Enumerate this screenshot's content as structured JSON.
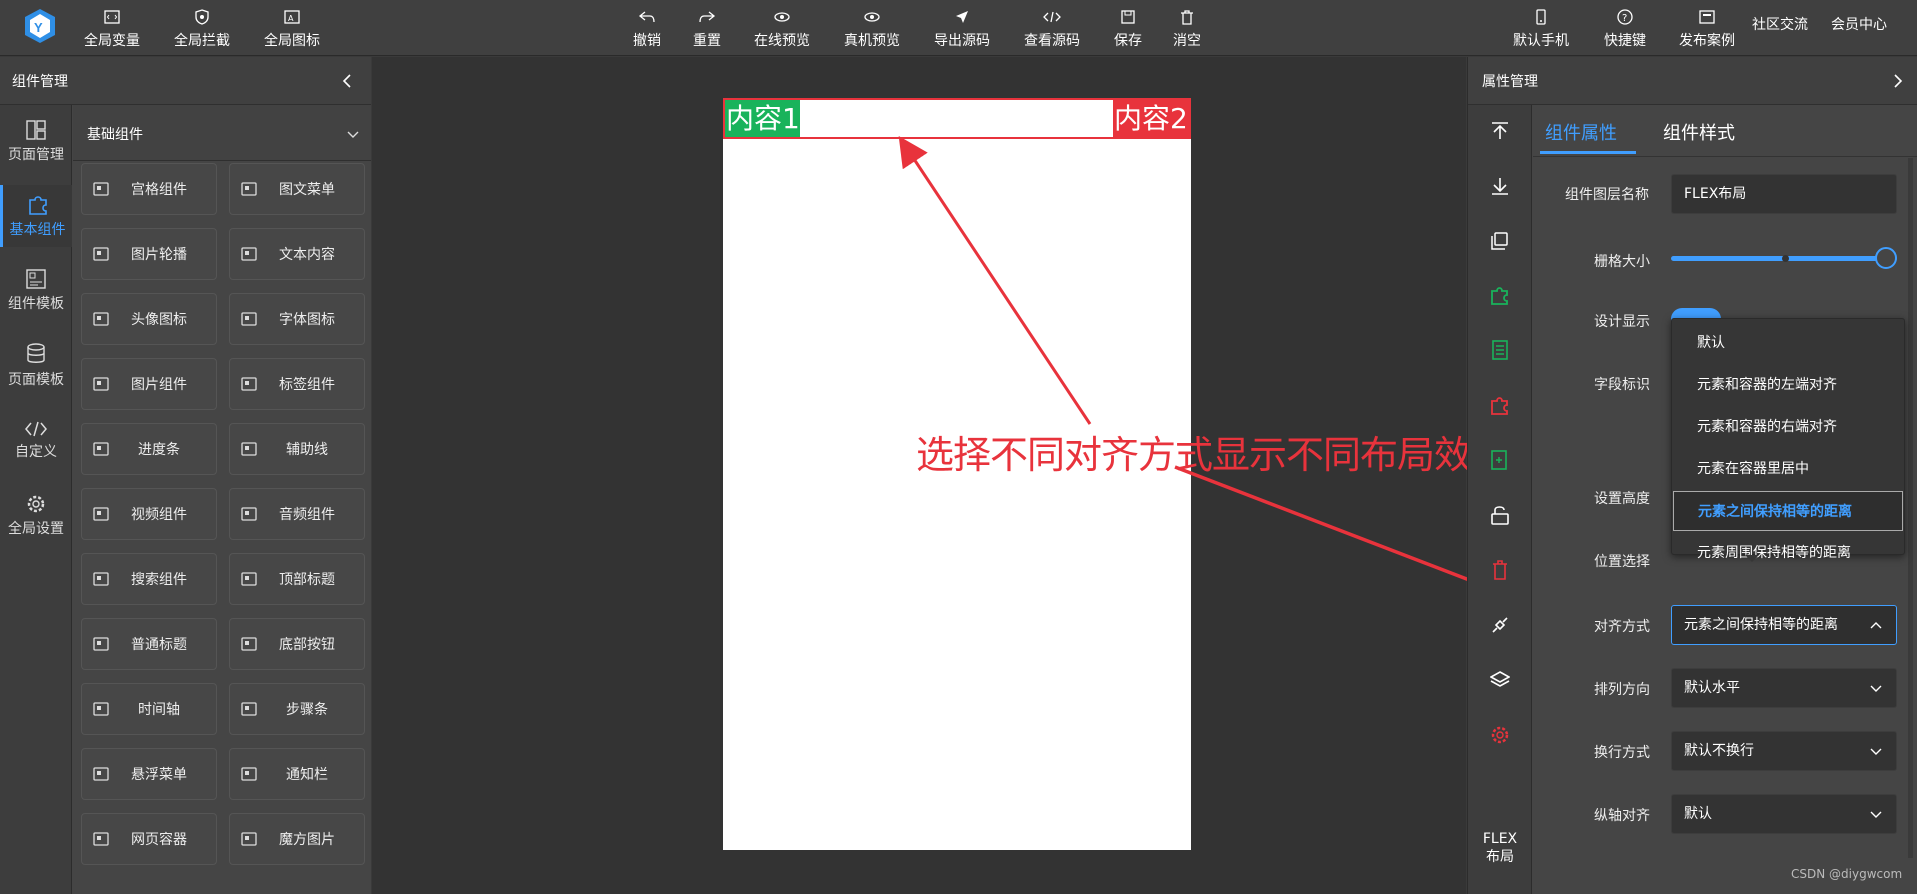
{
  "topbar": {
    "left": [
      {
        "label": "全局变量",
        "icon": "code-box-icon"
      },
      {
        "label": "全局拦截",
        "icon": "shield-icon"
      },
      {
        "label": "全局图标",
        "icon": "image-box-icon"
      }
    ],
    "center": [
      {
        "label": "撤销",
        "icon": "undo-icon"
      },
      {
        "label": "重置",
        "icon": "redo-icon"
      },
      {
        "label": "在线预览",
        "icon": "eye-icon"
      },
      {
        "label": "真机预览",
        "icon": "eye-icon"
      },
      {
        "label": "导出源码",
        "icon": "send-icon"
      },
      {
        "label": "查看源码",
        "icon": "code-icon"
      },
      {
        "label": "保存",
        "icon": "save-icon"
      },
      {
        "label": "消空",
        "icon": "trash-icon"
      }
    ],
    "right": [
      {
        "label": "默认手机",
        "icon": "phone-icon"
      },
      {
        "label": "快捷键",
        "icon": "question-icon"
      },
      {
        "label": "发布案例",
        "icon": "publish-icon"
      }
    ],
    "links": [
      "社区交流",
      "会员中心"
    ]
  },
  "left_panel": {
    "title": "组件管理",
    "nav": [
      {
        "label": "页面管理",
        "icon": "layout-icon",
        "active": false
      },
      {
        "label": "基本组件",
        "icon": "puzzle-icon",
        "active": true
      },
      {
        "label": "组件模板",
        "icon": "template-icon",
        "active": false
      },
      {
        "label": "页面模板",
        "icon": "database-icon",
        "active": false
      },
      {
        "label": "自定义",
        "icon": "code-icon",
        "active": false
      },
      {
        "label": "全局设置",
        "icon": "gear-icon",
        "active": false
      }
    ],
    "category": "基础组件",
    "components": [
      [
        "宫格组件",
        "图文菜单"
      ],
      [
        "图片轮播",
        "文本内容"
      ],
      [
        "头像图标",
        "字体图标"
      ],
      [
        "图片组件",
        "标签组件"
      ],
      [
        "进度条",
        "辅助线"
      ],
      [
        "视频组件",
        "音频组件"
      ],
      [
        "搜索组件",
        "顶部标题"
      ],
      [
        "普通标题",
        "底部按钮"
      ],
      [
        "时间轴",
        "步骤条"
      ],
      [
        "悬浮菜单",
        "通知栏"
      ],
      [
        "网页容器",
        "魔方图片"
      ]
    ]
  },
  "canvas": {
    "content1": "内容1",
    "content2": "内容2",
    "annotation": "选择不同对齐方式显示不同布局效果",
    "colors": {
      "content1": "#19b35b",
      "content2": "#e8333c",
      "annotation": "#e8333c"
    }
  },
  "right_panel": {
    "title": "属性管理",
    "tabs": [
      "组件属性",
      "组件样式"
    ],
    "tool_label": "FLEX布局",
    "props": {
      "layer_name_label": "组件图层名称",
      "layer_name_value": "FLEX布局",
      "grid_size_label": "栅格大小",
      "grid_size_value": 1.0,
      "design_show_label": "设计显示",
      "field_id_label": "字段标识",
      "height_label": "设置高度",
      "position_label": "位置选择",
      "align_label": "对齐方式",
      "align_value": "元素之间保持相等的距离",
      "direction_label": "排列方向",
      "direction_value": "默认水平",
      "wrap_label": "换行方式",
      "wrap_value": "默认不换行",
      "cross_label": "纵轴对齐",
      "cross_value": "默认"
    },
    "dropdown": {
      "options": [
        "默认",
        "元素和容器的左端对齐",
        "元素和容器的右端对齐",
        "元素在容器里居中",
        "元素之间保持相等的距离",
        "元素周围保持相等的距离"
      ],
      "selected_index": 4
    }
  },
  "watermark": "CSDN @diygwcom"
}
